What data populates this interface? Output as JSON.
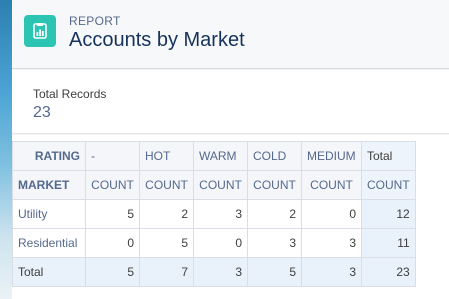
{
  "header": {
    "eyebrow": "REPORT",
    "title": "Accounts by Market",
    "icon": "report-icon",
    "icon_color": "#2cc5b3"
  },
  "summary": {
    "label": "Total Records",
    "value": "23"
  },
  "matrix": {
    "corner_row_label": "RATING",
    "corner_col_label": "MARKET",
    "columns": [
      "-",
      "HOT",
      "WARM",
      "COLD",
      "MEDIUM",
      "Total"
    ],
    "subheader": [
      "COUNT",
      "COUNT",
      "COUNT",
      "COUNT",
      "COUNT",
      "COUNT"
    ],
    "rows": [
      {
        "label": "Utility",
        "values": [
          "5",
          "2",
          "3",
          "2",
          "0",
          "12"
        ]
      },
      {
        "label": "Residential",
        "values": [
          "0",
          "5",
          "0",
          "3",
          "3",
          "11"
        ]
      }
    ],
    "total_row": {
      "label": "Total",
      "values": [
        "5",
        "7",
        "3",
        "5",
        "3",
        "23"
      ]
    }
  }
}
